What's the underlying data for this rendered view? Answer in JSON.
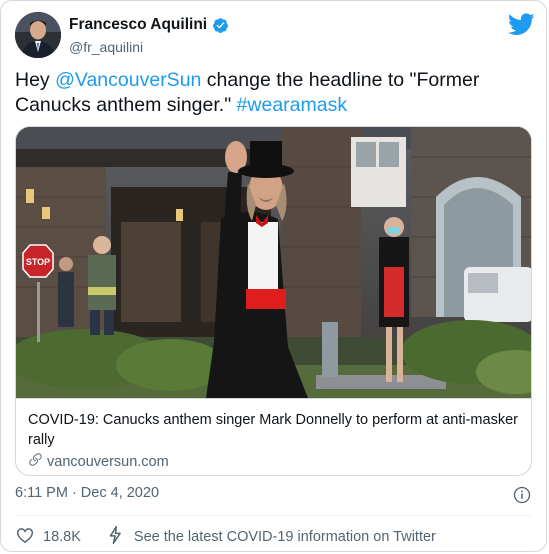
{
  "author": {
    "name": "Francesco Aquilini",
    "handle": "@fr_aquilini",
    "verified_icon": "verified-badge-icon",
    "avatar": "profile-photo"
  },
  "tweet": {
    "text_parts": {
      "p1": "Hey ",
      "mention": "@VancouverSun",
      "p2": " change the headline to \"Former Canucks anthem singer.\" ",
      "hashtag": "#wearamask"
    }
  },
  "card": {
    "title": "COVID-19: Canucks anthem singer Mark Donnelly to perform at anti-masker rally",
    "domain": "vancouversun.com",
    "image": "photo-of-singer-in-tuxedo-waving-outside-building",
    "stop_sign_text": "STOP"
  },
  "meta": {
    "timestamp": "6:11 PM · Dec 4, 2020"
  },
  "actions": {
    "like_count": "18.8K",
    "covid_info": "See the latest COVID-19 information on Twitter"
  },
  "colors": {
    "link": "#1d9bf0",
    "text": "#0f1419",
    "secondary": "#536471",
    "border": "#cfd9de"
  }
}
